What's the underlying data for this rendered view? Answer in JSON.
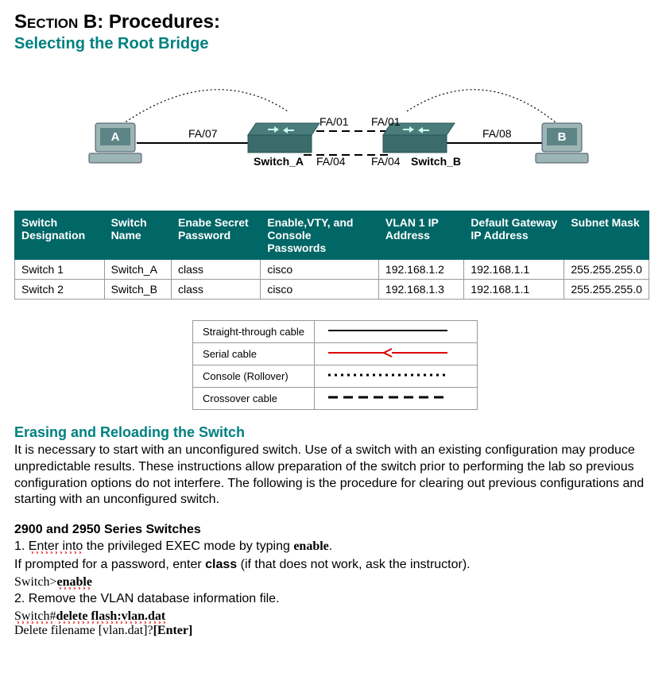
{
  "title_prefix": "S",
  "title_rest": "ection",
  "title_suffix": " B: Procedures:",
  "subtitle": "Selecting the Root Bridge",
  "diagram": {
    "pc_a": "A",
    "pc_b": "B",
    "fa07": "FA/07",
    "fa08": "FA/08",
    "fa01a": "FA/01",
    "fa01b": "FA/01",
    "fa04a": "FA/04",
    "fa04b": "FA/04",
    "sw_a": "Switch_A",
    "sw_b": "Switch_B"
  },
  "table": {
    "headers": {
      "designation": "Switch Designation",
      "name": "Switch Name",
      "secret": "Enabe Secret Password",
      "passwords": "Enable,VTY, and Console Passwords",
      "ip": "VLAN 1 IP Address",
      "gw": "Default Gateway IP Address",
      "mask": "Subnet Mask"
    },
    "rows": [
      {
        "designation": "Switch 1",
        "name": "Switch_A",
        "secret": "class",
        "passwords": "cisco",
        "ip": "192.168.1.2",
        "gw": "192.168.1.1",
        "mask": "255.255.255.0"
      },
      {
        "designation": "Switch 2",
        "name": "Switch_B",
        "secret": "class",
        "passwords": "cisco",
        "ip": "192.168.1.3",
        "gw": "192.168.1.1",
        "mask": "255.255.255.0"
      }
    ]
  },
  "legend": {
    "straight": "Straight-through cable",
    "serial": "Serial cable",
    "console": "Console (Rollover)",
    "crossover": "Crossover cable"
  },
  "erasing_heading": "Erasing and Reloading the Switch",
  "erasing_body": "It is necessary to start with an unconfigured switch. Use of a switch with an existing configuration may produce unpredictable results. These instructions allow preparation of the switch prior to performing the lab so previous configuration options do not interfere. The following is the procedure for clearing out previous configurations and starting with an unconfigured switch.",
  "series_heading": "2900 and 2950 Series Switches",
  "step1_a": "1. ",
  "step1_enter": "Enter into",
  "step1_b": " the privileged EXEC mode by typing ",
  "step1_enable": "enable",
  "step1_c": ".",
  "step1_hint_a": "If prompted for a password, enter ",
  "step1_hint_class": "class",
  "step1_hint_b": " (if that does not work, ask the instructor).",
  "cmd1_prompt": "Switch>",
  "cmd1_enable": "enable",
  "step2": "2. Remove the VLAN database information file.",
  "cmd2_prompt": "Switch#",
  "cmd2_delete": "delete flash:vlan.dat",
  "cmd3_a": "Delete filename [vlan.dat]?",
  "cmd3_b": "[Enter]"
}
